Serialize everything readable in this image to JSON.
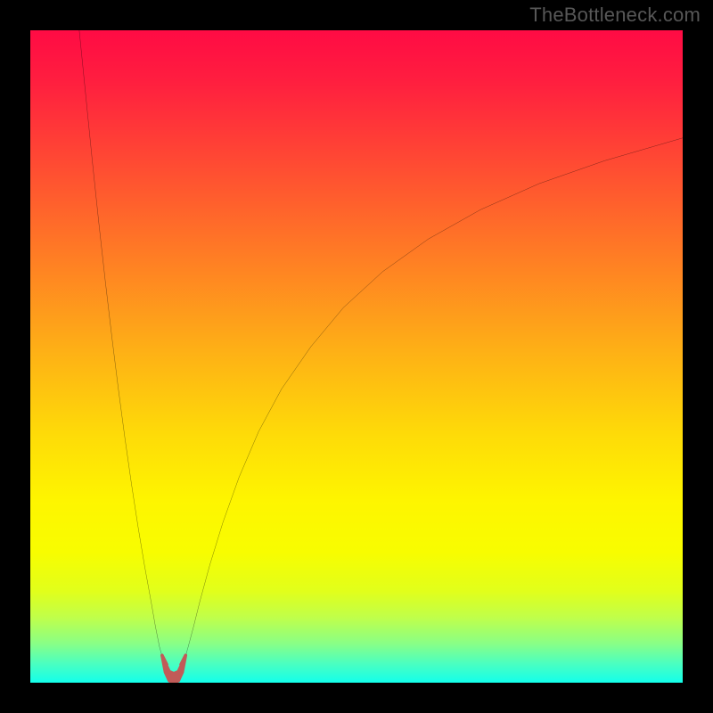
{
  "watermark": "TheBottleneck.com",
  "chart_data": {
    "type": "line",
    "title": "",
    "xlabel": "",
    "ylabel": "",
    "xlim": [
      0,
      100
    ],
    "ylim": [
      0,
      100
    ],
    "grid": false,
    "background": {
      "type": "vertical-gradient",
      "stops": [
        {
          "offset": 0.0,
          "color": "#ff0b44"
        },
        {
          "offset": 0.08,
          "color": "#ff1f3f"
        },
        {
          "offset": 0.2,
          "color": "#ff4933"
        },
        {
          "offset": 0.35,
          "color": "#ff7e24"
        },
        {
          "offset": 0.5,
          "color": "#feb315"
        },
        {
          "offset": 0.62,
          "color": "#fedb08"
        },
        {
          "offset": 0.72,
          "color": "#fef500"
        },
        {
          "offset": 0.8,
          "color": "#f8fd00"
        },
        {
          "offset": 0.86,
          "color": "#e1ff1b"
        },
        {
          "offset": 0.9,
          "color": "#c0ff4a"
        },
        {
          "offset": 0.94,
          "color": "#89ff86"
        },
        {
          "offset": 0.97,
          "color": "#4cffbf"
        },
        {
          "offset": 1.0,
          "color": "#13ffeb"
        }
      ]
    },
    "series": [
      {
        "name": "left-branch",
        "color": "#000000",
        "width": 2,
        "x": [
          7.5,
          8.5,
          9.5,
          10.5,
          11.5,
          12.5,
          13.5,
          14.5,
          15.5,
          16.5,
          17.5,
          18.5,
          19.2,
          19.8,
          20.5
        ],
        "y": [
          100,
          90,
          80,
          70.5,
          61.5,
          53,
          45,
          37.5,
          30.5,
          24,
          18,
          12.5,
          8.5,
          5.5,
          3.0
        ]
      },
      {
        "name": "right-branch",
        "color": "#000000",
        "width": 2,
        "x": [
          23.5,
          24.2,
          25.0,
          26.0,
          27.5,
          29.5,
          32.0,
          35.0,
          38.5,
          43.0,
          48.0,
          54.0,
          61.0,
          69.0,
          78.0,
          88.0,
          100.0
        ],
        "y": [
          3.0,
          5.5,
          8.5,
          12.5,
          18.0,
          24.5,
          31.5,
          38.5,
          45.0,
          51.5,
          57.5,
          63.0,
          68.0,
          72.5,
          76.5,
          80.0,
          83.5
        ]
      },
      {
        "name": "valley-marker",
        "type": "area",
        "color": "#c15b58",
        "x": [
          20.2,
          20.7,
          21.3,
          22.0,
          22.7,
          23.3,
          23.8
        ],
        "y": [
          4.2,
          1.6,
          0.3,
          0.0,
          0.3,
          1.6,
          4.2
        ]
      }
    ],
    "annotations": []
  },
  "colors": {
    "frame": "#000000",
    "watermark": "#575757"
  }
}
